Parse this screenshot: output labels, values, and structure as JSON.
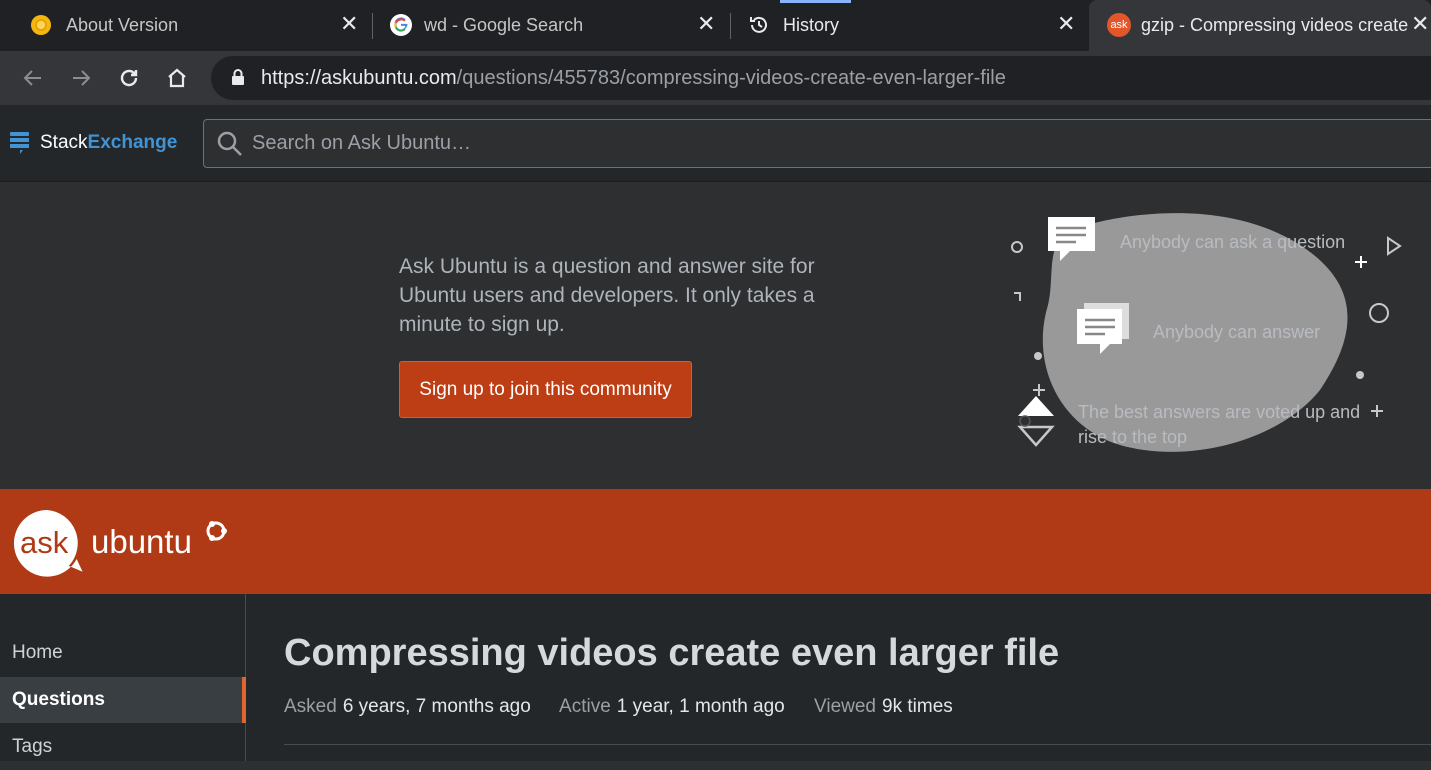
{
  "tabs": [
    {
      "title": "About Version",
      "icon": "chrome-canary-icon"
    },
    {
      "title": "wd - Google Search",
      "icon": "google-g-icon"
    },
    {
      "title": "History",
      "icon": "history-icon"
    },
    {
      "title": "gzip - Compressing videos create even larger file",
      "icon": "askubuntu-favicon",
      "favicon_text": "ask"
    }
  ],
  "toolbar": {
    "url_scheme": "https://",
    "url_host": "askubuntu.com",
    "url_path": "/questions/455783/compressing-videos-create-even-larger-file"
  },
  "stackexchange": {
    "logo_part1": "Stack",
    "logo_part2": "Exchange",
    "search_placeholder": "Search on Ask Ubuntu…"
  },
  "hero": {
    "description": "Ask Ubuntu is a question and answer site for Ubuntu users and developers. It only takes a minute to sign up.",
    "signup_label": "Sign up to join this community",
    "features": [
      "Anybody can ask a question",
      "Anybody can answer",
      "The best answers are voted up and",
      "rise to the top"
    ]
  },
  "site": {
    "logo_part1": "ask",
    "logo_part2": "ubuntu"
  },
  "nav": {
    "items": [
      "Home",
      "Questions",
      "Tags"
    ]
  },
  "question": {
    "title": "Compressing videos create even larger file",
    "asked_label": "Asked",
    "asked_value": "6 years, 7 months ago",
    "active_label": "Active",
    "active_value": "1 year, 1 month ago",
    "viewed_label": "Viewed",
    "viewed_value": "9k times"
  },
  "colors": {
    "accent_orange": "#b03a16",
    "button_orange": "#bd3d14",
    "se_blue": "#4293d4"
  }
}
